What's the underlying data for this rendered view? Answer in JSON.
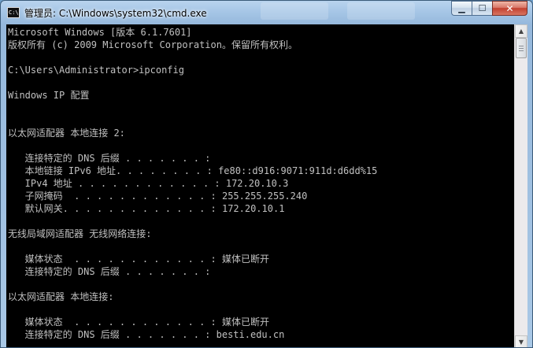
{
  "window": {
    "title": "管理员: C:\\Windows\\system32\\cmd.exe",
    "app_icon_text": "C:\\",
    "minimize_glyph": "▁",
    "maximize_glyph": "☐",
    "close_glyph": "✕"
  },
  "console": {
    "lines": [
      "Microsoft Windows [版本 6.1.7601]",
      "版权所有 (c) 2009 Microsoft Corporation。保留所有权利。",
      "",
      "C:\\Users\\Administrator>ipconfig",
      "",
      "Windows IP 配置",
      "",
      "",
      "以太网适配器 本地连接 2:",
      "",
      "   连接特定的 DNS 后缀 . . . . . . . :",
      "   本地链接 IPv6 地址. . . . . . . . : fe80::d916:9071:911d:d6dd%15",
      "   IPv4 地址 . . . . . . . . . . . . : 172.20.10.3",
      "   子网掩码  . . . . . . . . . . . . : 255.255.255.240",
      "   默认网关. . . . . . . . . . . . . : 172.20.10.1",
      "",
      "无线局域网适配器 无线网络连接:",
      "",
      "   媒体状态  . . . . . . . . . . . . : 媒体已断开",
      "   连接特定的 DNS 后缀 . . . . . . . :",
      "",
      "以太网适配器 本地连接:",
      "",
      "   媒体状态  . . . . . . . . . . . . : 媒体已断开",
      "   连接特定的 DNS 后缀 . . . . . . . : besti.edu.cn"
    ]
  },
  "scrollbar": {
    "up_glyph": "▲",
    "down_glyph": "▼",
    "thumb_start": 0.0,
    "thumb_fraction": 0.07
  },
  "colors": {
    "console_bg": "#000000",
    "console_text": "#c0c0c0",
    "close_button": "#c2402f"
  }
}
